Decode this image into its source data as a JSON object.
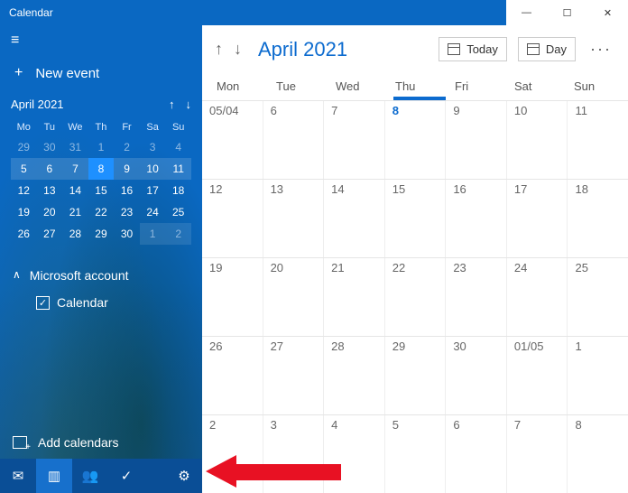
{
  "window": {
    "title": "Calendar",
    "min": "—",
    "max": "☐",
    "close": "✕"
  },
  "sidebar": {
    "hamburger": "≡",
    "new_event_plus": "+",
    "new_event_label": "New event",
    "minical": {
      "title": "April 2021",
      "up": "↑",
      "down": "↓",
      "dow": [
        "Mo",
        "Tu",
        "We",
        "Th",
        "Fr",
        "Sa",
        "Su"
      ],
      "rows": [
        [
          {
            "d": "29",
            "dim": true
          },
          {
            "d": "30",
            "dim": true
          },
          {
            "d": "31",
            "dim": true
          },
          {
            "d": "1",
            "dim": true
          },
          {
            "d": "2",
            "dim": true
          },
          {
            "d": "3",
            "dim": true
          },
          {
            "d": "4",
            "dim": true
          }
        ],
        [
          {
            "d": "5",
            "sel": true
          },
          {
            "d": "6",
            "sel": true
          },
          {
            "d": "7",
            "sel": true
          },
          {
            "d": "8",
            "today": true
          },
          {
            "d": "9",
            "sel": true
          },
          {
            "d": "10",
            "sel": true
          },
          {
            "d": "11",
            "sel": true
          }
        ],
        [
          {
            "d": "12"
          },
          {
            "d": "13"
          },
          {
            "d": "14"
          },
          {
            "d": "15"
          },
          {
            "d": "16"
          },
          {
            "d": "17"
          },
          {
            "d": "18"
          }
        ],
        [
          {
            "d": "19"
          },
          {
            "d": "20"
          },
          {
            "d": "21"
          },
          {
            "d": "22"
          },
          {
            "d": "23"
          },
          {
            "d": "24"
          },
          {
            "d": "25"
          }
        ],
        [
          {
            "d": "26"
          },
          {
            "d": "27"
          },
          {
            "d": "28"
          },
          {
            "d": "29"
          },
          {
            "d": "30"
          },
          {
            "d": "1",
            "sel": true,
            "dim": true
          },
          {
            "d": "2",
            "sel": true,
            "dim": true
          }
        ]
      ]
    },
    "account_label": "Microsoft account",
    "account_chevron": "∧",
    "calendar_check": "✓",
    "calendar_label": "Calendar",
    "add_calendars": "Add calendars",
    "bottom": {
      "mail": "✉",
      "calendar": "▥",
      "people": "👥",
      "todo": "✓",
      "settings": "⚙"
    }
  },
  "content": {
    "nav_up": "↑",
    "nav_down": "↓",
    "month_title": "April 2021",
    "today_label": "Today",
    "day_label": "Day",
    "more": "···",
    "dow": [
      "Mon",
      "Tue",
      "Wed",
      "Thu",
      "Fri",
      "Sat",
      "Sun"
    ],
    "today_index": 3,
    "rows": [
      [
        "05/04",
        "6",
        "7",
        "8",
        "9",
        "10",
        "11"
      ],
      [
        "12",
        "13",
        "14",
        "15",
        "16",
        "17",
        "18"
      ],
      [
        "19",
        "20",
        "21",
        "22",
        "23",
        "24",
        "25"
      ],
      [
        "26",
        "27",
        "28",
        "29",
        "30",
        "01/05",
        "1"
      ],
      [
        "2",
        "3",
        "4",
        "5",
        "6",
        "7",
        "8"
      ]
    ],
    "today_cell": [
      0,
      3
    ]
  }
}
